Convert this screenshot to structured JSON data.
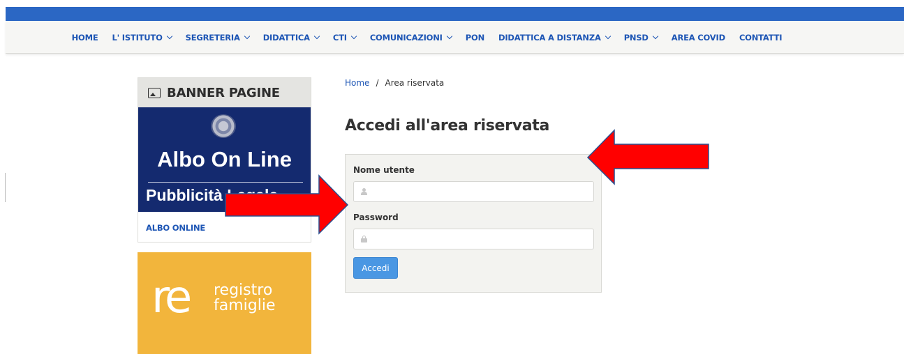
{
  "nav": {
    "items": [
      {
        "label": "HOME",
        "dropdown": false
      },
      {
        "label": "L' ISTITUTO",
        "dropdown": true
      },
      {
        "label": "SEGRETERIA",
        "dropdown": true
      },
      {
        "label": "DIDATTICA",
        "dropdown": true
      },
      {
        "label": "CTI",
        "dropdown": true
      },
      {
        "label": "COMUNICAZIONI",
        "dropdown": true
      },
      {
        "label": "PON",
        "dropdown": false
      },
      {
        "label": "DIDATTICA A DISTANZA",
        "dropdown": true
      },
      {
        "label": "PNSD",
        "dropdown": true
      },
      {
        "label": "AREA COVID",
        "dropdown": false
      },
      {
        "label": "CONTATTI",
        "dropdown": false
      }
    ]
  },
  "sidebar": {
    "banner_title": "BANNER PAGINE",
    "albo": {
      "title": "Albo On Line",
      "subtitle": "Pubblicità Legale",
      "link": "ALBO ONLINE"
    },
    "registro": {
      "logo": "re",
      "line1": "registro",
      "line2": "famiglie"
    }
  },
  "breadcrumb": {
    "home": "Home",
    "separator": "/",
    "current": "Area riservata"
  },
  "page_title": "Accedi all'area riservata",
  "login": {
    "username_label": "Nome utente",
    "username_value": "",
    "password_label": "Password",
    "password_value": "",
    "submit_label": "Accedi"
  },
  "colors": {
    "brand_blue": "#2b67c4",
    "link_blue": "#1e56b5",
    "button_blue": "#4a97e3",
    "albo_navy": "#142a6f",
    "registro_yellow": "#f2b53c",
    "arrow_red": "#ff0000"
  }
}
